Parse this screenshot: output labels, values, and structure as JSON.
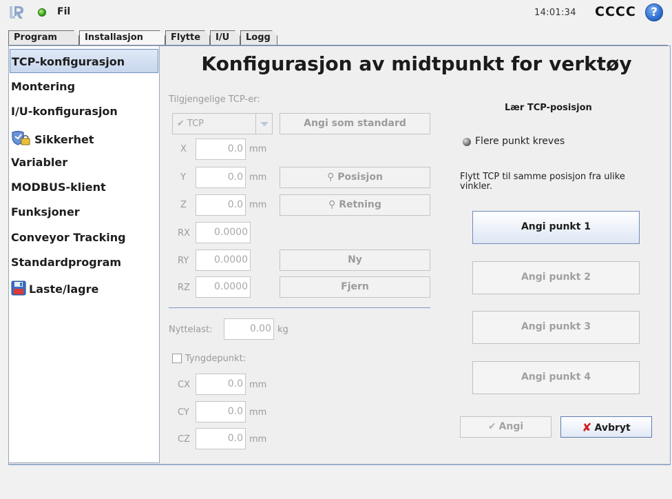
{
  "topbar": {
    "file_label": "Fil",
    "clock": "14:01:34",
    "robot_name": "CCCC",
    "help_glyph": "?"
  },
  "tabs": [
    {
      "label": "Program",
      "active": false
    },
    {
      "label": "Installasjon",
      "active": true
    },
    {
      "label": "Flytte",
      "active": false
    },
    {
      "label": "I/U",
      "active": false
    },
    {
      "label": "Logg",
      "active": false
    }
  ],
  "sidebar": {
    "items": [
      {
        "label": "TCP-konfigurasjon",
        "active": true
      },
      {
        "label": "Montering"
      },
      {
        "label": "I/U-konfigurasjon"
      },
      {
        "label": "Sikkerhet",
        "icon": "shield-lock-icon"
      },
      {
        "label": "Variabler"
      },
      {
        "label": "MODBUS-klient"
      },
      {
        "label": "Funksjoner"
      },
      {
        "label": "Conveyor Tracking"
      },
      {
        "label": "Standardprogram"
      },
      {
        "label": "Laste/lagre",
        "icon": "floppy-disk-icon"
      }
    ]
  },
  "main": {
    "title": "Konfigurasjon av midtpunkt for verktøy",
    "available_label": "Tilgjengelige TCP-er:",
    "tcp_select": "TCP",
    "set_default_button": "Angi som standard",
    "position_button": "Posisjon",
    "orientation_button": "Retning",
    "new_button": "Ny",
    "remove_button": "Fjern",
    "coords": {
      "x": {
        "label": "X",
        "value": "0.0",
        "unit": "mm"
      },
      "y": {
        "label": "Y",
        "value": "0.0",
        "unit": "mm"
      },
      "z": {
        "label": "Z",
        "value": "0.0",
        "unit": "mm"
      },
      "rx": {
        "label": "RX",
        "value": "0.0000"
      },
      "ry": {
        "label": "RY",
        "value": "0.0000"
      },
      "rz": {
        "label": "RZ",
        "value": "0.0000"
      }
    },
    "payload_label": "Nyttelast:",
    "payload_value": "0.00",
    "payload_unit": "kg",
    "cog_label": "Tyngdepunkt:",
    "cog": {
      "cx": {
        "label": "CX",
        "value": "0.0",
        "unit": "mm"
      },
      "cy": {
        "label": "CY",
        "value": "0.0",
        "unit": "mm"
      },
      "cz": {
        "label": "CZ",
        "value": "0.0",
        "unit": "mm"
      }
    }
  },
  "teach": {
    "title": "Lær TCP-posisjon",
    "indicator_text": "Flere punkt kreves",
    "instruction": "Flytt TCP til samme posisjon fra ulike vinkler.",
    "points": [
      "Angi punkt 1",
      "Angi punkt 2",
      "Angi punkt 3",
      "Angi punkt 4"
    ],
    "apply_button": "Angi",
    "cancel_button": "Avbryt"
  },
  "colors": {
    "accent": "#6e8fc2",
    "status_ok": "#3fae1c",
    "cancel_red": "#d21f1f"
  }
}
